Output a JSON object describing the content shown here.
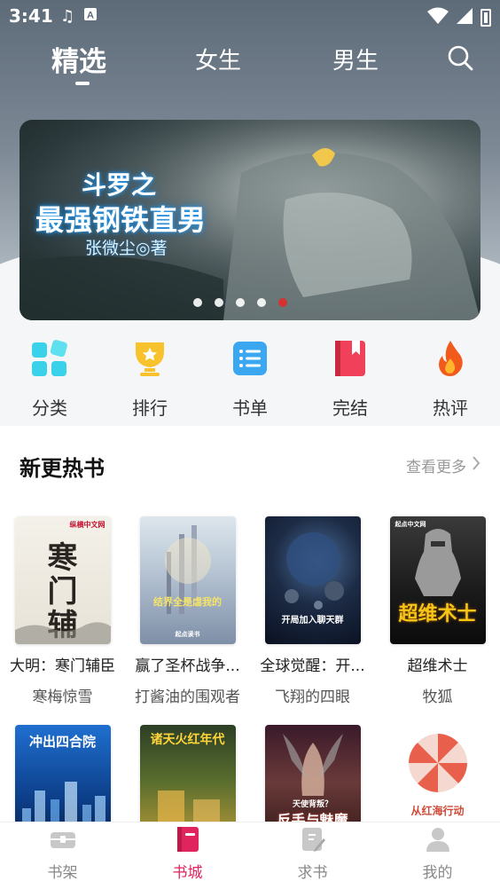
{
  "status_bar": {
    "time": "3:41",
    "icons_left": [
      "music-note-icon",
      "a-notification-icon"
    ],
    "icons_right": [
      "wifi-icon",
      "signal-icon",
      "battery-charging-icon"
    ]
  },
  "top_tabs": {
    "tabs": [
      {
        "label": "精选",
        "active": true
      },
      {
        "label": "女生",
        "active": false
      },
      {
        "label": "男生",
        "active": false
      }
    ],
    "search_icon": "search-icon"
  },
  "banner": {
    "title_line1": "斗罗之",
    "title_line2": "最强钢铁直男",
    "author": "张微尘◎著",
    "dot_count": 5,
    "active_dot": 4
  },
  "categories": [
    {
      "label": "分类",
      "icon": "grid-icon",
      "color": "#3ad1ea"
    },
    {
      "label": "排行",
      "icon": "trophy-icon",
      "color": "#f7c22c"
    },
    {
      "label": "书单",
      "icon": "list-icon",
      "color": "#3aa7f0"
    },
    {
      "label": "完结",
      "icon": "book-icon",
      "color": "#f0405a"
    },
    {
      "label": "热评",
      "icon": "flame-icon",
      "color": "#f25a1c"
    }
  ],
  "section": {
    "title": "新更热书",
    "more_label": "查看更多"
  },
  "books": [
    {
      "title": "大明：寒门辅臣",
      "author": "寒梅惊雪",
      "cover_text": "寒门辅臣",
      "cover_badge": "纵横中文网"
    },
    {
      "title": "赢了圣杯战争...",
      "author": "打酱油的围观者",
      "cover_text": "结界全是虐我的",
      "cover_badge": "起点读书"
    },
    {
      "title": "全球觉醒：开...",
      "author": "飞翔的四眼",
      "cover_text": "开局加入聊天群",
      "cover_badge": ""
    },
    {
      "title": "超维术士",
      "author": "牧狐",
      "cover_text": "超维术士",
      "cover_badge": "起点中文网"
    },
    {
      "title": "",
      "author": "",
      "cover_text": "冲出四合院",
      "cover_badge": ""
    },
    {
      "title": "",
      "author": "",
      "cover_text": "诸天火红年代",
      "cover_badge": ""
    },
    {
      "title": "",
      "author": "",
      "cover_text": "反手与魅魔",
      "cover_badge": "天使背叛？"
    },
    {
      "title": "",
      "author": "",
      "cover_text": "从红海行动",
      "cover_badge": ""
    }
  ],
  "bottom_nav": [
    {
      "label": "书架",
      "icon": "bookshelf-icon",
      "active": false
    },
    {
      "label": "书城",
      "icon": "bookstore-icon",
      "active": true
    },
    {
      "label": "求书",
      "icon": "request-book-icon",
      "active": false
    },
    {
      "label": "我的",
      "icon": "profile-icon",
      "active": false
    }
  ],
  "colors": {
    "accent": "#e0245e",
    "active_dot": "#e02b2b",
    "muted_text": "#999999"
  }
}
